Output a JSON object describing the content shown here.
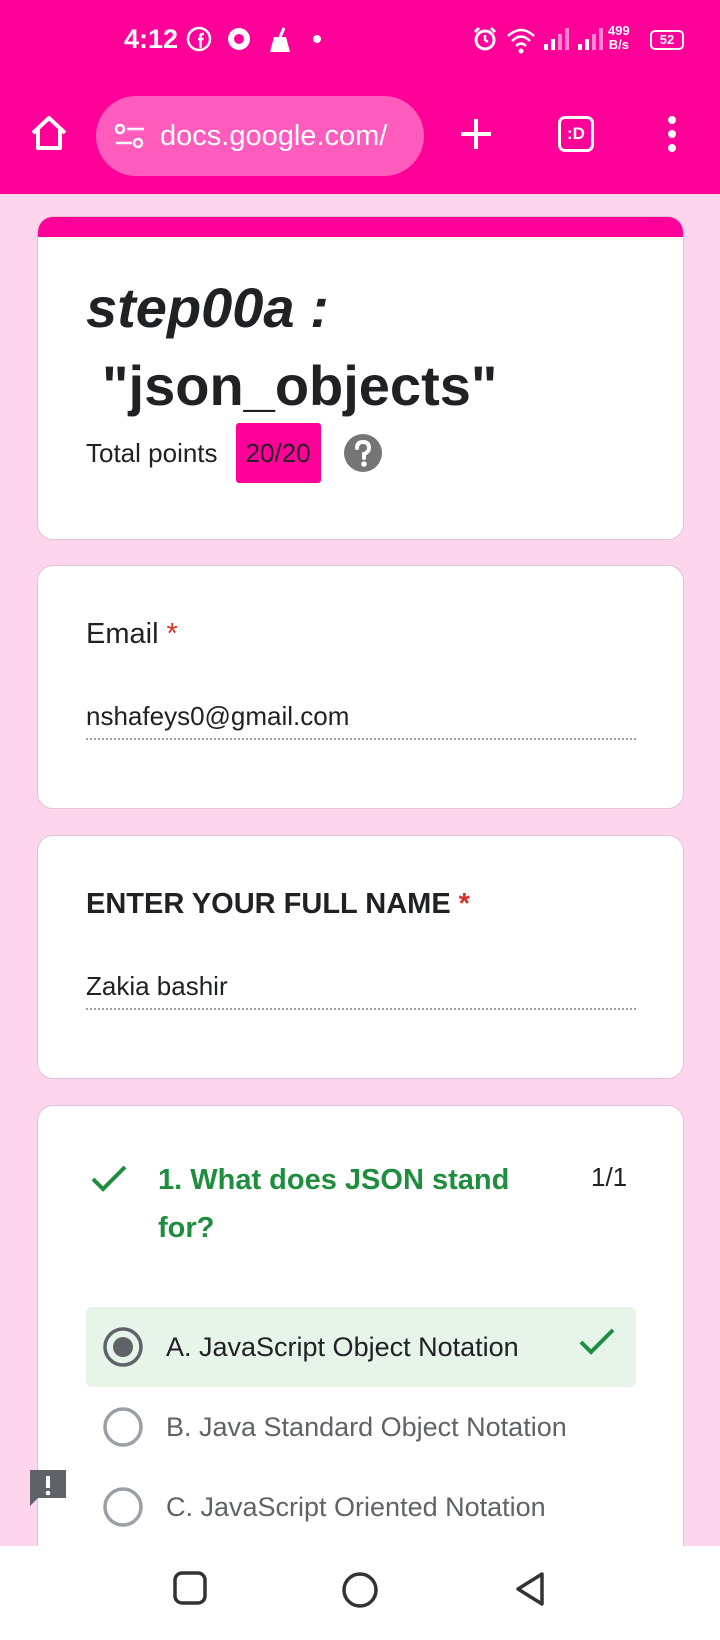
{
  "status_bar": {
    "time": "4:12",
    "net_speed_value": "499",
    "net_speed_unit": "B/s",
    "battery": "52"
  },
  "browser": {
    "url": "docs.google.com/",
    "tab_label": ":D"
  },
  "colors": {
    "brand": "#ff0099",
    "background": "#fdd6ee",
    "correct_green": "#1e8e3e",
    "required_red": "#d93025"
  },
  "form": {
    "title_line1": "step00a :",
    "title_line2": "\"json_objects\"",
    "total_points_label": "Total points",
    "total_points_value": "20/20"
  },
  "email_question": {
    "label": "Email",
    "required_mark": "*",
    "value": "nshafeys0@gmail.com"
  },
  "name_question": {
    "label": "ENTER YOUR FULL NAME",
    "required_mark": "*",
    "value": "Zakia bashir"
  },
  "question1": {
    "text": "1.  What does JSON stand for?",
    "score": "1/1",
    "options": [
      {
        "label": "A. JavaScript Object Notation",
        "selected": true,
        "correct": true
      },
      {
        "label": "B. Java Standard Object Notation",
        "selected": false,
        "correct": false
      },
      {
        "label": "C. JavaScript Oriented Notation",
        "selected": false,
        "correct": false
      }
    ]
  }
}
